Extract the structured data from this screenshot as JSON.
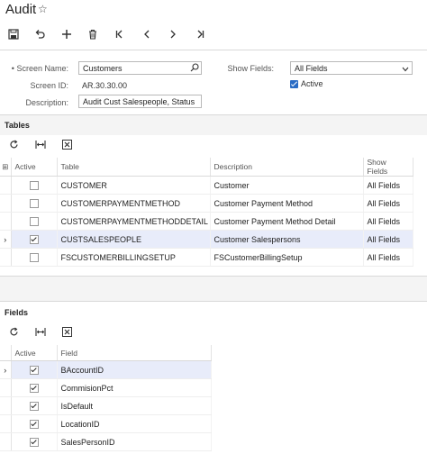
{
  "app": {
    "title": "Audit"
  },
  "toolbar": {
    "icons": [
      "save-icon",
      "undo-icon",
      "add-icon",
      "delete-icon",
      "first-icon",
      "prev-icon",
      "next-icon",
      "last-icon"
    ]
  },
  "form": {
    "screen_name_label": "Screen Name:",
    "screen_name_value": "Customers",
    "screen_id_label": "Screen ID:",
    "screen_id_value": "AR.30.30.00",
    "description_label": "Description:",
    "description_value": "Audit Cust Salespeople, Status",
    "show_fields_label": "Show Fields:",
    "show_fields_value": "All Fields",
    "active_label": "Active",
    "active_checked": true
  },
  "tables": {
    "section_title": "Tables",
    "columns": [
      "Active",
      "Table",
      "Description",
      "Show Fields"
    ],
    "rows": [
      {
        "active": false,
        "table": "CUSTOMER",
        "description": "Customer",
        "show_fields": "All Fields",
        "selected": false
      },
      {
        "active": false,
        "table": "CUSTOMERPAYMENTMETHOD",
        "description": "Customer Payment Method",
        "show_fields": "All Fields",
        "selected": false
      },
      {
        "active": false,
        "table": "CUSTOMERPAYMENTMETHODDETAIL",
        "description": "Customer Payment Method Detail",
        "show_fields": "All Fields",
        "selected": false
      },
      {
        "active": true,
        "table": "CUSTSALESPEOPLE",
        "description": "Customer Salespersons",
        "show_fields": "All Fields",
        "selected": true
      },
      {
        "active": false,
        "table": "FSCUSTOMERBILLINGSETUP",
        "description": "FSCustomerBillingSetup",
        "show_fields": "All Fields",
        "selected": false
      }
    ]
  },
  "fields": {
    "section_title": "Fields",
    "columns": [
      "Active",
      "Field"
    ],
    "rows": [
      {
        "active": true,
        "field": "BAccountID",
        "selected": true
      },
      {
        "active": true,
        "field": "CommisionPct",
        "selected": false
      },
      {
        "active": true,
        "field": "IsDefault",
        "selected": false
      },
      {
        "active": true,
        "field": "LocationID",
        "selected": false
      },
      {
        "active": true,
        "field": "SalesPersonID",
        "selected": false
      }
    ]
  },
  "colors": {
    "accent": "#2a6cc5",
    "selected_row": "#e8ecfa"
  }
}
